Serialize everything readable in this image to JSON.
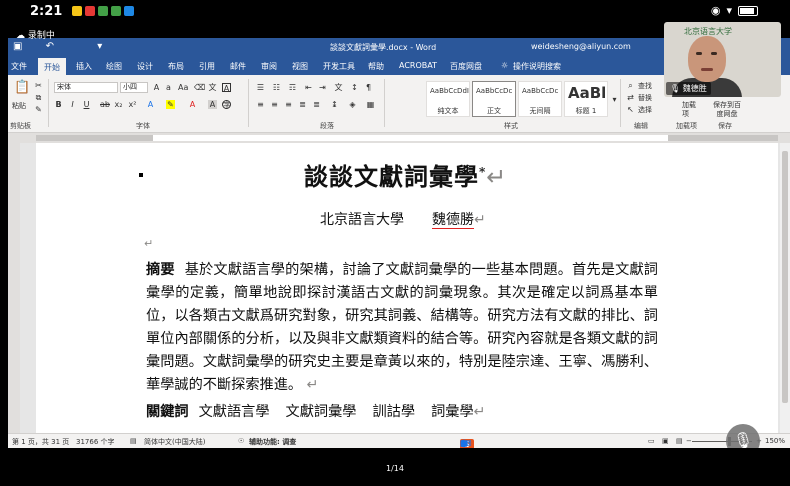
{
  "status_bar": {
    "time": "2:21"
  },
  "recording": {
    "label": "录制中"
  },
  "titlebar": {
    "doc_title": "談談文獻詞彙學.docx - Word",
    "user": "weidesheng@aliyun.com"
  },
  "tabs": [
    "文件",
    "开始",
    "插入",
    "绘图",
    "设计",
    "布局",
    "引用",
    "邮件",
    "审阅",
    "视图",
    "开发工具",
    "帮助",
    "ACROBAT",
    "百度网盘",
    "操作说明搜索"
  ],
  "active_tab": "开始",
  "ribbon": {
    "paste": "粘贴",
    "font_name": "宋体",
    "font_size": "小四",
    "clipboard_label": "剪贴板",
    "font_label": "字体",
    "paragraph_label": "段落",
    "styles_label": "样式",
    "editing_label": "编辑",
    "addins_label": "加载项",
    "save_label": "保存",
    "styles": [
      {
        "sample": "AaBbCcDdI",
        "name": "纯文本"
      },
      {
        "sample": "AaBbCcDc",
        "name": "正文"
      },
      {
        "sample": "AaBbCcDc",
        "name": "无间隔"
      },
      {
        "sample": "AaBl",
        "name": "标题 1"
      }
    ],
    "find": "查找",
    "replace": "替换",
    "select": "选择",
    "addins": "加载项",
    "save_to": "保存到百度网盘"
  },
  "document": {
    "title": "談談文獻詞彙學",
    "title_mark": "*",
    "affiliation": "北京語言大學",
    "author": "魏德勝",
    "abstract_label": "摘要",
    "abstract_text": "基於文獻語言學的架構，討論了文獻詞彙學的一些基本問題。首先是文獻詞彙學的定義，簡單地說即探討漢語古文獻的詞彙現象。其次是確定以詞爲基本單位，以各類古文獻爲研究對象，研究其詞義、結構等。研究方法有文獻的排比、詞單位內部關係的分析，以及與非文獻類資料的結合等。研究內容就是各類文獻的詞彙問題。文獻詞彙學的研究史主要是章黃以來的，特別是陸宗達、王寧、馮勝利、華學誠的不斷探索推進。",
    "keywords_label": "關鍵詞",
    "keywords": [
      "文獻語言學",
      "文獻詞彙學",
      "訓詁學",
      "詞彙學"
    ]
  },
  "word_status": {
    "page": "第 1 页，共 31 页",
    "words": "31766 个字",
    "language": "简体中文(中国大陆)",
    "accessibility": "辅助功能: 调查",
    "zoom": "150%"
  },
  "webcam": {
    "name": "魏德胜",
    "logo": "北京语言大学"
  },
  "bottom": {
    "page_count": "1/14"
  },
  "colors": {
    "word_blue": "#2b579a",
    "ribbon_bg": "#f3f2f1",
    "ime_orange": "#e8521c"
  }
}
